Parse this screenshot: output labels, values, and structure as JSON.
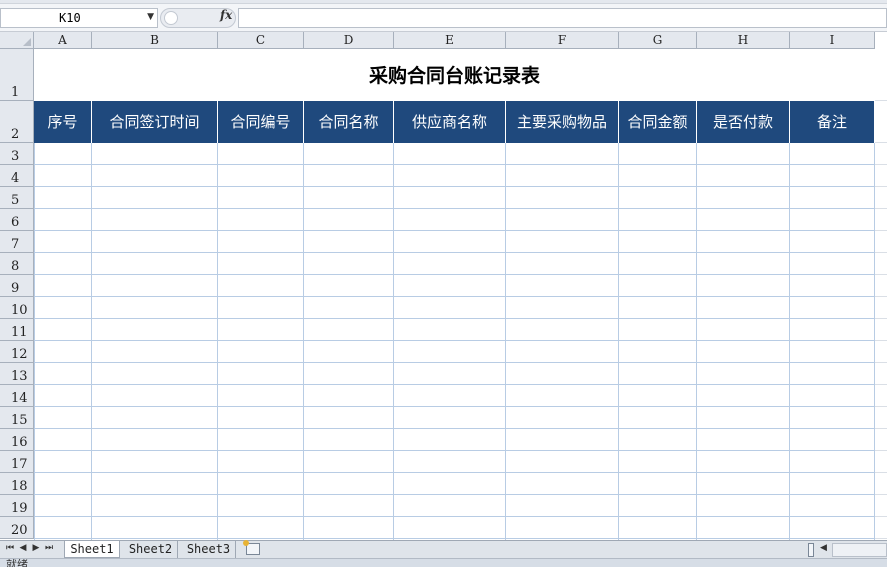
{
  "formula_bar": {
    "name_box": "K10",
    "fx_label": "fx",
    "formula": ""
  },
  "columns": [
    "A",
    "B",
    "C",
    "D",
    "E",
    "F",
    "G",
    "H",
    "I"
  ],
  "rows": [
    "1",
    "2",
    "3",
    "4",
    "5",
    "6",
    "7",
    "8",
    "9",
    "10",
    "11",
    "12",
    "13",
    "14",
    "15",
    "16",
    "17",
    "18",
    "19",
    "20"
  ],
  "sheet": {
    "title": "采购合同台账记录表",
    "headers": [
      "序号",
      "合同签订时间",
      "合同编号",
      "合同名称",
      "供应商名称",
      "主要采购物品",
      "合同金额",
      "是否付款",
      "备注"
    ]
  },
  "tabs": {
    "nav_first": "⏮",
    "nav_prev": "◀",
    "nav_next": "▶",
    "nav_last": "⏭",
    "sheets": [
      "Sheet1",
      "Sheet2",
      "Sheet3"
    ]
  },
  "status": {
    "text": "就绪"
  },
  "colors": {
    "header_fill": "#1f497d",
    "header_text": "#ffffff",
    "grid_line": "#b8cce4"
  },
  "icons": {
    "fx": "function-icon",
    "new_sheet": "insert-sheet-icon",
    "dropdown": "chevron-down-icon"
  }
}
